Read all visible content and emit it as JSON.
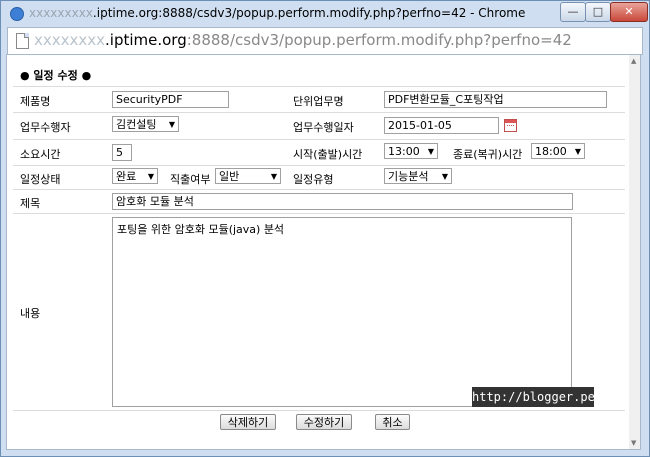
{
  "window": {
    "title_blurred": "xxxxxxxxx",
    "title": ".iptime.org:8888/csdv3/popup.perform.modify.php?perfno=42 - Chrome",
    "minimize_glyph": "—",
    "maximize_glyph": "□",
    "close_glyph": "✕"
  },
  "address": {
    "blurred": "xxxxxxxx",
    "host": ".iptime.org",
    "path": ":8888/csdv3/popup.perform.modify.php?perfno=42"
  },
  "form": {
    "section_title": "● 일정 수정 ●",
    "product_label": "제품명",
    "product_value": "SecurityPDF",
    "unit_task_label": "단위업무명",
    "unit_task_value": "PDF변환모듈_C포팅작업",
    "performer_label": "업무수행자",
    "performer_value": "김컨설팅",
    "perform_date_label": "업무수행일자",
    "perform_date_value": "2015-01-05",
    "duration_label": "소요시간",
    "duration_value": "5",
    "start_label": "시작(출발)시간",
    "start_value": "13:00",
    "end_label": "종료(복귀)시간",
    "end_value": "18:00",
    "status_label": "일정상태",
    "status_value": "완료",
    "direct_label": "직출여부",
    "direct_value": "일반",
    "type_label": "일정유형",
    "type_value": "기능분석",
    "subject_label": "제목",
    "subject_value": "암호화 모듈 분석",
    "content_label": "내용",
    "content_value": "포팅을 위한 암호화 모듈(java) 분석"
  },
  "buttons": {
    "delete": "삭제하기",
    "modify": "수정하기",
    "cancel": "취소"
  },
  "watermark": "http://blogger.pe.kr",
  "colors": {
    "frame": "#cfdff1",
    "close_button": "#c9483a",
    "watermark_bg": "#333333"
  }
}
